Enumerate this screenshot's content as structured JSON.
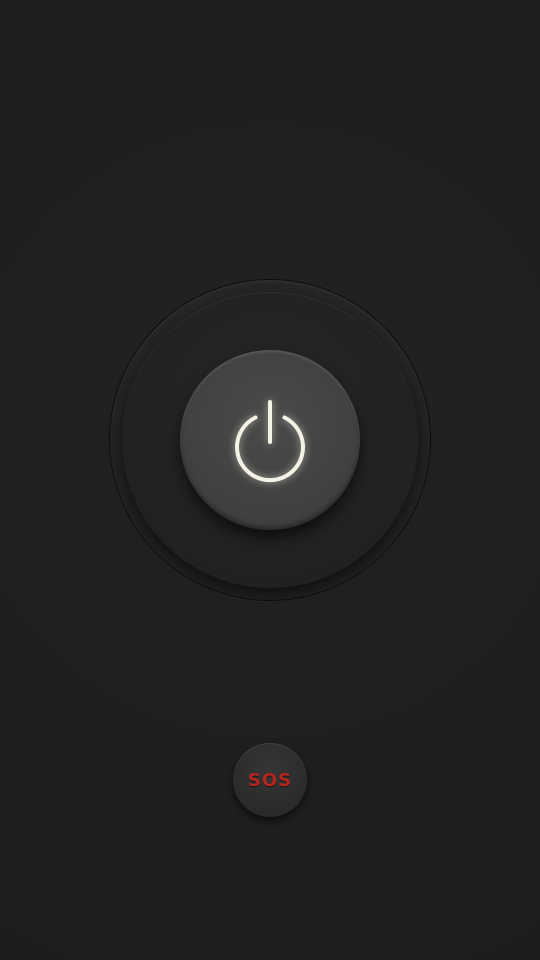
{
  "app": {
    "state": "off"
  },
  "power_button": {
    "icon": "power-icon",
    "icon_color": "#f4f2e6"
  },
  "sos_button": {
    "label": "SOS",
    "label_color": "#b3261e"
  },
  "colors": {
    "background": "#1f1f1f",
    "ring": "#242424",
    "button": "#444444"
  }
}
